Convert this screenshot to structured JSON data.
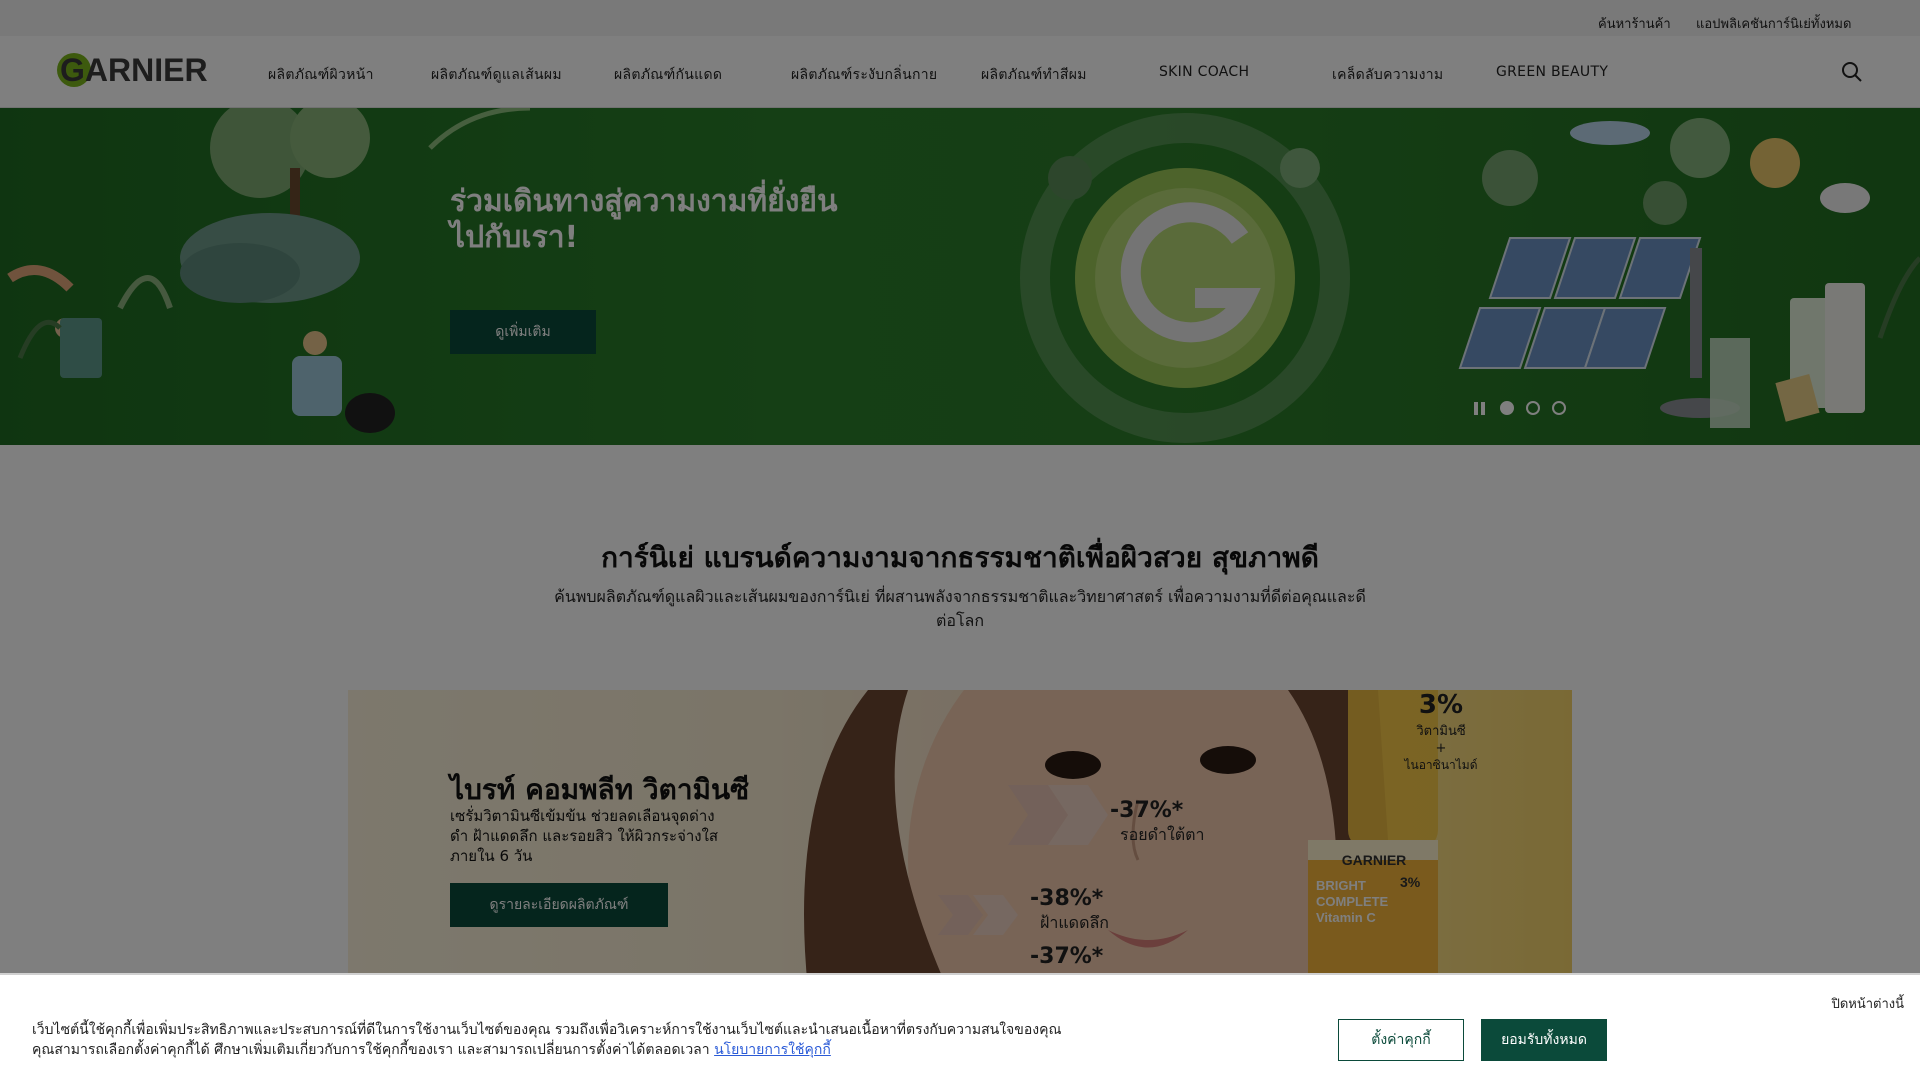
{
  "topbar": {
    "link1": "ค้นหาร้านค้า",
    "link2": "แอปพลิเคชันการ์นิเย่ทั้งหมด"
  },
  "header": {
    "brand": "GARNIER",
    "nav": [
      "ผลิตภัณฑ์ผิวหน้า",
      "ผลิตภัณฑ์ดูแลเส้นผม",
      "ผลิตภัณฑ์กันแดด",
      "ผลิตภัณฑ์ระงับกลิ่นกาย",
      "ผลิตภัณฑ์ทำสีผม",
      "SKIN COACH",
      "เคล็ดลับความงาม",
      "GREEN BEAUTY"
    ]
  },
  "hero": {
    "title": "ร่วมเดินทางสู่ความงามที่ยั่งยืนไปกับเรา!",
    "button": "ดูเพิ่มเติม",
    "slides": 3,
    "active_slide": 1
  },
  "intro": {
    "title": "การ์นิเย่ แบรนด์ความงามจากธรรมชาติเพื่อผิวสวย สุขภาพดี",
    "text": "ค้นพบผลิตภัณฑ์ดูแลผิวและเส้นผมของการ์นิเย่ ที่ผสานพลังจากธรรมชาติและวิทยาศาสตร์ เพื่อความงามที่ดีต่อคุณและดีต่อโลก"
  },
  "promo": {
    "title": "ไบรท์ คอมพลีท วิตามินซี",
    "text": "เซรั่มวิตามินซีเข้มข้น ช่วยลดเลือนจุดด่างดำ ฝ้าแดดลึก และรอยสิว ให้ผิวกระจ่างใส ภายใน 6 วัน",
    "button": "ดูรายละเอียดผลิตภัณฑ์",
    "badge_pct": "3%",
    "badge_text1": "วิตามินซี",
    "badge_plus": "+",
    "badge_text2": "ไนอาซินาไมด์",
    "stats": [
      {
        "value": "-37%*",
        "label": "รอยดำใต้ตา"
      },
      {
        "value": "-38%*",
        "label": "ฝ้าแดดลึก"
      },
      {
        "value": "-37%*",
        "label": ""
      }
    ],
    "product_brand": "GARNIER",
    "product_name": "BRIGHT COMPLETE Vitamin C",
    "product_pct": "3%"
  },
  "cookie": {
    "close": "ปิดหน้าต่างนี้",
    "text": "เว็บไซต์นี้ใช้คุกกี้เพื่อเพิ่มประสิทธิภาพและประสบการณ์ที่ดีในการใช้งานเว็บไซต์ของคุณ รวมถึงเพื่อวิเคราะห์การใช้งานเว็บไซต์และนำเสนอเนื้อหาที่ตรงกับความสนใจของคุณ คุณสามารถเลือกตั้งค่าคุกกี้ได้ ศึกษาเพิ่มเติมเกี่ยวกับการใช้คุกกี้ของเรา และสามารถเปลี่ยนการตั้งค่าได้ตลอดเวลา",
    "link": "นโยบายการใช้คุกกี้",
    "settings": "ตั้งค่าคุกกี้",
    "accept": "ยอมรับทั้งหมด"
  },
  "colors": {
    "brand_green": "#0b4a3a",
    "hero_green": "#2a7e2a",
    "logo_green": "#7ab51d"
  }
}
